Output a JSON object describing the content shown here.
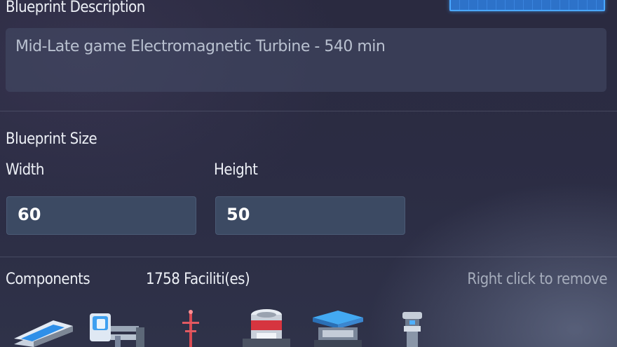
{
  "description": {
    "label": "Blueprint  Description",
    "value": "Mid-Late game Electromagnetic Turbine - 540 min"
  },
  "size": {
    "label": "Blueprint Size",
    "width_label": "Width",
    "width_value": "60",
    "height_label": "Height",
    "height_value": "50"
  },
  "components": {
    "label": "Components",
    "count": "1758 Faciliti(es)",
    "hint": "Right click to remove",
    "items": [
      {
        "icon": "conveyor-belt-icon"
      },
      {
        "icon": "sorter-icon"
      },
      {
        "icon": "power-pole-icon"
      },
      {
        "icon": "storage-tank-icon"
      },
      {
        "icon": "assembler-icon"
      },
      {
        "icon": "wind-turbine-icon"
      }
    ]
  },
  "colors": {
    "accent": "#4aa7ff",
    "field_bg": "#3c4a63"
  }
}
